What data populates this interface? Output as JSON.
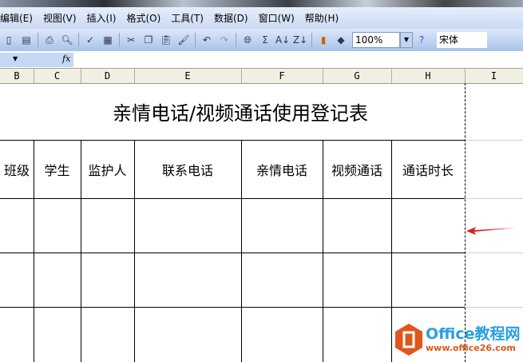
{
  "menu": [
    "编辑(E)",
    "视图(V)",
    "插入(I)",
    "格式(O)",
    "工具(T)",
    "数据(D)",
    "窗口(W)",
    "帮助(H)"
  ],
  "toolbar": {
    "zoom": "100%",
    "font": "宋体",
    "fx": "fx"
  },
  "columns": [
    "B",
    "C",
    "D",
    "E",
    "F",
    "G",
    "H",
    "I"
  ],
  "sheet": {
    "title": "亲情电话/视频通话使用登记表",
    "headers": [
      "班级",
      "学生",
      "监护人",
      "联系电话",
      "亲情电话",
      "视频通话",
      "通话时长"
    ]
  },
  "watermark": {
    "brand": "Office教程网",
    "url": "www.office26.com"
  },
  "colors": {
    "arrow": "#d42020",
    "logo": "#e0561b",
    "brand": "#2a9fe0"
  }
}
